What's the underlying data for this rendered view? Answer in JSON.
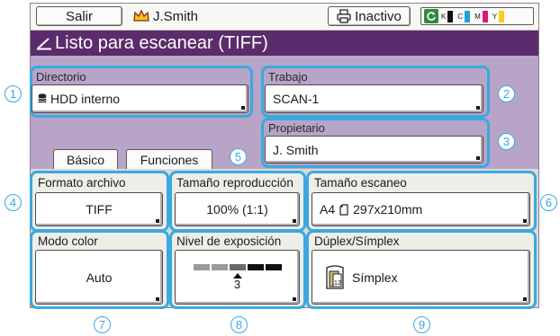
{
  "topbar": {
    "logout_label": "Salir",
    "user_name": "J.Smith",
    "status_label": "Inactivo",
    "toner": [
      {
        "letter": "K",
        "color": "#111111"
      },
      {
        "letter": "C",
        "color": "#1aa3d9"
      },
      {
        "letter": "M",
        "color": "#d81b7a"
      },
      {
        "letter": "Y",
        "color": "#f4d11a"
      }
    ]
  },
  "title": "Listo para escanear (TIFF)",
  "directory": {
    "label": "Directorio",
    "value": "HDD interno"
  },
  "job": {
    "label": "Trabajo",
    "value": "SCAN-1"
  },
  "owner": {
    "label": "Propietario",
    "value": "J. Smith"
  },
  "tabs": {
    "basic": "Básico",
    "functions": "Funciones"
  },
  "settings": {
    "file_format": {
      "label": "Formato archivo",
      "value": "TIFF"
    },
    "repro_size": {
      "label": "Tamaño reproducción",
      "value": "100% (1:1)"
    },
    "scan_size": {
      "label": "Tamaño escaneo",
      "value": "A4",
      "dimensions": "297x210mm"
    },
    "color_mode": {
      "label": "Modo color",
      "value": "Auto"
    },
    "exposure": {
      "label": "Nivel de exposición",
      "value": "3",
      "level": 3,
      "max": 5
    },
    "duplex": {
      "label": "Dúplex/Símplex",
      "value": "Símplex"
    }
  },
  "callouts": [
    "1",
    "2",
    "3",
    "4",
    "5",
    "6",
    "7",
    "8",
    "9"
  ],
  "colors": {
    "title_bg": "#5a2c6b",
    "panel_bg": "#b8a4c7",
    "highlight": "#39a9e1"
  }
}
